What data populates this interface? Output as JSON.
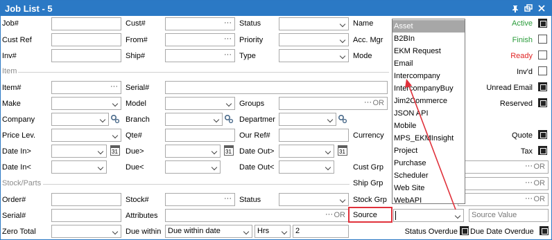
{
  "window": {
    "title": "Job List - 5",
    "pin_icon": "pin-icon",
    "restore_icon": "restore-icon",
    "close_icon": "close-icon"
  },
  "labels": {
    "job": "Job#",
    "cust_ref": "Cust Ref",
    "inv": "Inv#",
    "cust": "Cust#",
    "from": "From#",
    "ship": "Ship#",
    "status": "Status",
    "priority": "Priority",
    "type": "Type",
    "name": "Name",
    "acc_mgr": "Acc. Mgr",
    "mode": "Mode",
    "item_section": "Item",
    "item": "Item#",
    "make": "Make",
    "company": "Company",
    "price_lev": "Price Lev.",
    "date_in_gt": "Date In>",
    "date_in_lt": "Date In<",
    "serial": "Serial#",
    "model": "Model",
    "branch": "Branch",
    "qte": "Qte#",
    "due_gt": "Due>",
    "due_lt": "Due<",
    "groups": "Groups",
    "departmer": "Departmer",
    "our_ref": "Our Ref#",
    "date_out_gt": "Date Out>",
    "date_out_lt": "Date Out<",
    "currency": "Currency",
    "cust_grp": "Cust Grp",
    "ship_grp": "Ship Grp",
    "stock_grp": "Stock Grp",
    "source": "Source",
    "stock_section": "Stock/Parts",
    "order": "Order#",
    "serial2": "Serial#",
    "zero_total": "Zero Total",
    "stock": "Stock#",
    "attributes": "Attributes",
    "due_within": "Due within",
    "status2": "Status",
    "active": "Active",
    "finish": "Finish",
    "ready": "Ready",
    "invd": "Inv'd",
    "unread_email": "Unread Email",
    "reserved": "Reserved",
    "quote": "Quote",
    "tax": "Tax",
    "status_overdue": "Status Overdue",
    "due_date_overdue": "Due Date Overdue",
    "or": "OR",
    "dots": "···",
    "cal_day": "31"
  },
  "fields": {
    "due_within_value": "Due within date",
    "hrs_value": "Hrs",
    "number_value": "2",
    "source_value_placeholder": "Source Value"
  },
  "checks": {
    "active": true,
    "finish": false,
    "ready": false,
    "invd": false,
    "unread_email": true,
    "reserved": true,
    "quote": true,
    "tax": true,
    "status_overdue": true,
    "due_date_overdue": true
  },
  "source_options": [
    "Asset",
    "B2BIn",
    "EKM Request",
    "Email",
    "Intercompany",
    "IntercompanyBuy",
    "Jim2Commerce",
    "JSON API",
    "Mobile",
    "MPS_EKMInsight",
    "Project",
    "Purchase",
    "Scheduler",
    "Web Site",
    "WebAPI"
  ],
  "source_selected": "Asset",
  "colors": {
    "titlebar": "#2b79c5",
    "active": "#2a9b3a",
    "ready": "#e02424",
    "annotation": "#e0303a"
  }
}
